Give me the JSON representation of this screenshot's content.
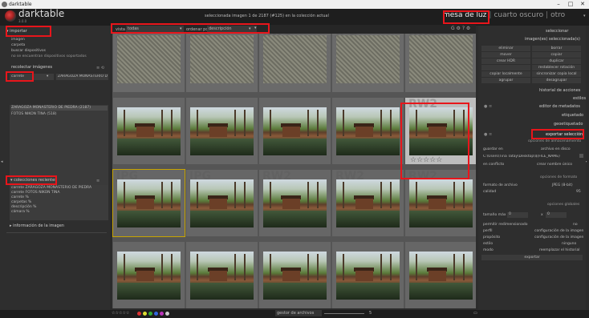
{
  "window": {
    "title": "darktable"
  },
  "app": {
    "name": "darktable",
    "version": "3.0.0"
  },
  "status": "seleccionada imagen 1 de 2187 (#125) en la colección actual",
  "views": {
    "active": "mesa de luz",
    "sep": "|",
    "items": [
      "cuarto oscuro",
      "otro"
    ]
  },
  "filter": {
    "view_label": "vista",
    "view_value": "todas",
    "order_label": "ordenar por",
    "order_value": "descripción"
  },
  "left": {
    "import": {
      "title": "importar",
      "items": [
        "imagen",
        "carpeta",
        "buscar dispositivos",
        "no se encuentran dispositivos soportados"
      ]
    },
    "collect": {
      "title": "recolectar imágenes",
      "field": "carrete",
      "value": "ZARAGOZA MONASTERIO DE PIEDRA",
      "items": [
        "ZARAGOZA MONASTERIO DE PIEDRA (2187)",
        "FOTOS NIKON TINA (518)"
      ]
    },
    "recent": {
      "title": "colecciones recientes",
      "items": [
        "carrete ZARAGOZA MONASTERIO DE PIEDRA",
        "carrete FOTOS NIKON TINA",
        "carrete %",
        "carpetas %",
        "descripción %",
        "cámara %"
      ]
    },
    "info": {
      "title": "información de la imagen"
    }
  },
  "right": {
    "select": "seleccionar",
    "selected": {
      "title": "imagen(es) seleccionada(s)",
      "buttons": [
        "eliminar",
        "borrar",
        "mover",
        "copiar",
        "crear HDR",
        "duplicar",
        "",
        "restablecer rotación",
        "copiar localmente",
        "sincronizar copia local",
        "agrupar",
        "desagrupar"
      ]
    },
    "sections": [
      "historial de acciones",
      "estilos",
      "editor de metadatos",
      "etiquetado",
      "geoetiquetado",
      "exportar selección"
    ],
    "storage": {
      "header": "opciones de almacenamiento",
      "target_label": "guardar en",
      "target_value": "archivo en disco",
      "path": "C:\\Users\\Tina Tatay\\Desktop\\$(FILE_NAME)",
      "conflict_label": "en conflicto",
      "conflict_value": "crear nombre único"
    },
    "format": {
      "header": "opciones de formato",
      "type_label": "formato de archivo",
      "type_value": "JPEG (8-bit)",
      "quality_label": "calidad",
      "quality_value": "95"
    },
    "global": {
      "header": "opciones globales",
      "size_label": "tamaño máx",
      "w": "0",
      "h": "0",
      "x": "x",
      "upscale_label": "permitir redimensionado",
      "upscale_value": "no",
      "profile_label": "perfil",
      "profile_value": "configuración de la imagen",
      "intent_label": "propósito",
      "intent_value": "configuración de la imagen",
      "style_label": "estilo",
      "style_value": "ninguno",
      "mode_label": "modo",
      "mode_value": "reemplazar el historial"
    },
    "export_button": "exportar"
  },
  "grid": {
    "watermarks": [
      "JPG",
      "JPG",
      "RW2",
      "JPG",
      "RW2",
      "",
      "",
      "",
      "",
      "RW2",
      "JPG",
      "JPG",
      "RW2",
      "RW2",
      "RW2",
      "",
      "",
      "",
      "",
      ""
    ]
  },
  "bottom": {
    "stars": "☆☆☆☆☆",
    "view_mode": "gestor de archivos",
    "zoom": "5",
    "colors": [
      "#d33",
      "#dd3",
      "#3a3",
      "#36d",
      "#b3b",
      "#ccc"
    ]
  }
}
